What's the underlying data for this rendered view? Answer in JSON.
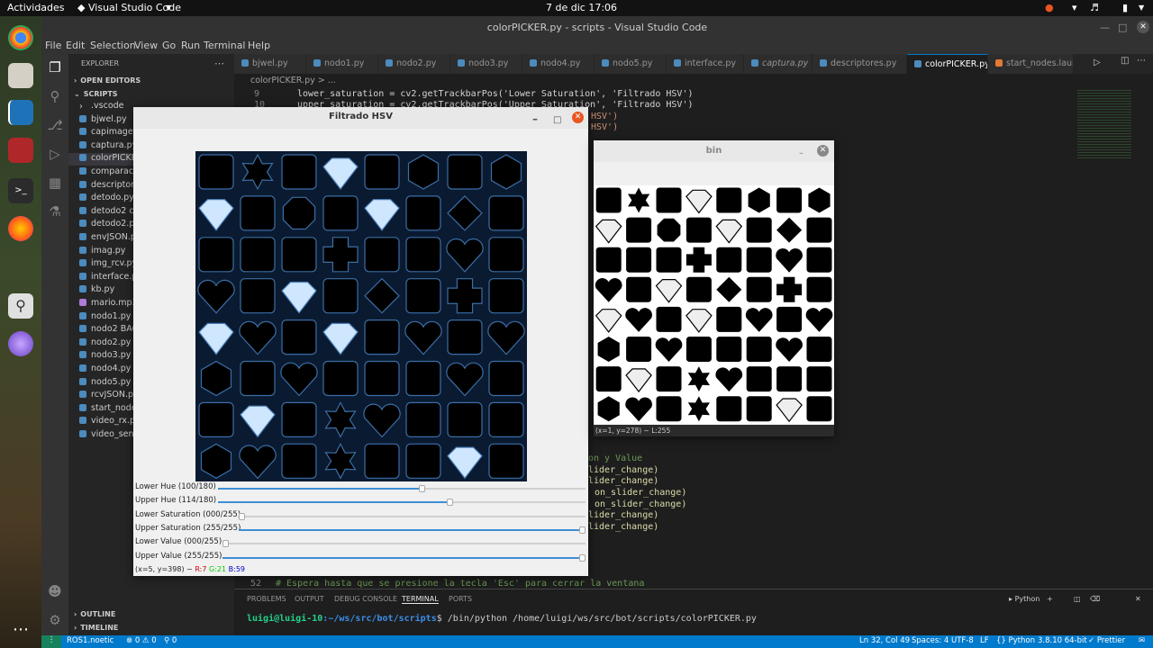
{
  "os": {
    "activities": "Actividades",
    "app_menu": "Visual Studio Code",
    "clock": "7 de dic  17:06"
  },
  "vscode": {
    "window_title": "colorPICKER.py - scripts - Visual Studio Code",
    "menu": [
      "File",
      "Edit",
      "Selection",
      "View",
      "Go",
      "Run",
      "Terminal",
      "Help"
    ],
    "explorer_title": "EXPLORER",
    "open_editors": "OPEN EDITORS",
    "folder": "SCRIPTS",
    "files": [
      ".vscode",
      "bjwel.py",
      "capimagen.py",
      "captura.py",
      "colorPICKER.py",
      "comparacion",
      "descriptores",
      "detodo.py",
      "detodo2 copy",
      "detodo2.py",
      "envJSON.py",
      "imag.py",
      "img_rcv.py",
      "interface.py",
      "kb.py",
      "mario.mp3",
      "nodo1.py",
      "nodo2 BACKUP",
      "nodo2.py",
      "nodo3.py",
      "nodo4.py",
      "nodo5.py",
      "rcvJSON.py",
      "start_nodes",
      "video_rx.py",
      "video_send."
    ],
    "outline": "OUTLINE",
    "timeline": "TIMELINE",
    "tabs": [
      "bjwel.py",
      "nodo1.py",
      "nodo2.py",
      "nodo3.py",
      "nodo4.py",
      "nodo5.py",
      "interface.py",
      "captura.py",
      "descriptores.py",
      "colorPICKER.py",
      "start_nodes.launch"
    ],
    "breadcrumb": "colorPICKER.py > ...",
    "code": {
      "ln9": "9",
      "line9": "lower_saturation = cv2.getTrackbarPos('Lower Saturation', 'Filtrado HSV')",
      "ln10": "10",
      "line10": "upper_saturation = cv2.getTrackbarPos('Upper Saturation', 'Filtrado HSV')",
      "frag1": "HSV')",
      "frag2": "HSV')",
      "frag3": "on y Value",
      "frag4": "lider_change)",
      "frag5": "lider_change)",
      "frag6": "on_slider_change)",
      "frag7": "on_slider_change)",
      "frag8": "lider_change)",
      "frag9": "lider_change)",
      "ln52": "52",
      "line52": "# Espera hasta que se presione la tecla 'Esc' para cerrar la ventana"
    },
    "panel_tabs": [
      "PROBLEMS",
      "OUTPUT",
      "DEBUG CONSOLE",
      "TERMINAL",
      "PORTS"
    ],
    "terminal_kind": "Python",
    "terminal_prompt_user": "luigi@luigi-10",
    "terminal_prompt_path": ":~/ws/src/bot/scripts",
    "terminal_command": "$ /bin/python /home/luigi/ws/src/bot/scripts/colorPICKER.py",
    "status": {
      "remote": "ROS1.noetic",
      "problems": "⊗ 0 ⚠ 0",
      "ports": "⚲ 0",
      "position": "Ln 32, Col 49",
      "spaces": "Spaces: 4",
      "encoding": "UTF-8",
      "eol": "LF",
      "language": "{} Python",
      "interpreter": "3.8.10 64-bit",
      "prettier": "✓ Prettier"
    }
  },
  "hsv_window": {
    "title": "Filtrado HSV",
    "sliders": [
      {
        "label": "Lower Hue  (100/180)",
        "fraction": 0.556
      },
      {
        "label": "Upper Hue  (114/180)",
        "fraction": 0.633
      },
      {
        "label": "Lower Saturation (000/255)",
        "fraction": 0.0
      },
      {
        "label": "Upper Saturation (255/255)",
        "fraction": 1.0
      },
      {
        "label": "Lower Value (000/255)",
        "fraction": 0.0
      },
      {
        "label": "Upper Value (255/255)",
        "fraction": 1.0
      }
    ],
    "status_coords": "(x=5, y=398) ~",
    "status_r": "R:7",
    "status_g": "G:21",
    "status_b": "B:59"
  },
  "bin_window": {
    "title": "bin",
    "status": "(x=1, y=278) ~ L:255"
  },
  "colors": {
    "accent": "#007acc",
    "close": "#e95420",
    "slider": "#3d8fd5"
  }
}
